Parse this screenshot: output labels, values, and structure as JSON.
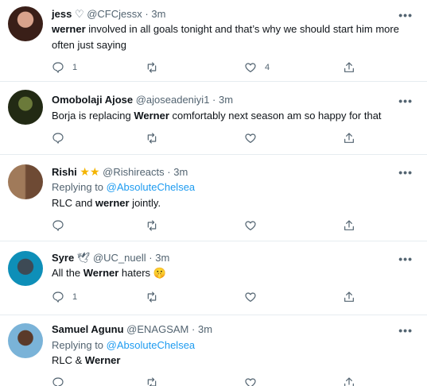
{
  "tweets": [
    {
      "name": "jess",
      "name_suffix": "♡",
      "handle": "@CFCjessx",
      "time": "3m",
      "text_parts": [
        {
          "bold": true,
          "t": "werner"
        },
        {
          "bold": false,
          "t": " involved in all goals tonight and that’s why we should start him more often just saying"
        }
      ],
      "reply_count": "1",
      "retweet_count": "",
      "like_count": "4"
    },
    {
      "name": "Omobolaji Ajose",
      "handle": "@ajoseadeniyi1",
      "time": "3m",
      "text_parts": [
        {
          "bold": false,
          "t": "Borja is replacing "
        },
        {
          "bold": true,
          "t": "Werner"
        },
        {
          "bold": false,
          "t": " comfortably next season am so happy for that"
        }
      ],
      "reply_count": "",
      "retweet_count": "",
      "like_count": ""
    },
    {
      "name": "Rishi",
      "name_suffix": "★★",
      "handle": "@Rishireacts",
      "time": "3m",
      "replying_to_label": "Replying to",
      "replying_to_handle": "@AbsoluteChelsea",
      "text_parts": [
        {
          "bold": false,
          "t": "RLC and "
        },
        {
          "bold": true,
          "t": "werner"
        },
        {
          "bold": false,
          "t": " jointly."
        }
      ],
      "reply_count": "",
      "retweet_count": "",
      "like_count": ""
    },
    {
      "name": "Syre",
      "name_suffix": "🕊",
      "handle": "@UC_nuell",
      "time": "3m",
      "text_parts": [
        {
          "bold": false,
          "t": "All the "
        },
        {
          "bold": true,
          "t": "Werner"
        },
        {
          "bold": false,
          "t": " haters 🤫"
        }
      ],
      "reply_count": "1",
      "retweet_count": "",
      "like_count": ""
    },
    {
      "name": "Samuel Agunu",
      "handle": "@ENAGSAM",
      "time": "3m",
      "replying_to_label": "Replying to",
      "replying_to_handle": "@AbsoluteChelsea",
      "text_parts": [
        {
          "bold": false,
          "t": "RLC & "
        },
        {
          "bold": true,
          "t": "Werner"
        }
      ],
      "reply_count": "",
      "retweet_count": "",
      "like_count": ""
    }
  ],
  "dot_separator": "·",
  "more_glyph": "•••",
  "colors": {
    "link": "#1d9bf0",
    "secondary": "#536471",
    "divider": "#e6ecf0",
    "star": "#f4b400"
  },
  "icons": {
    "reply": "reply-icon",
    "retweet": "retweet-icon",
    "like": "heart-icon",
    "share": "share-icon",
    "more": "more-icon"
  }
}
